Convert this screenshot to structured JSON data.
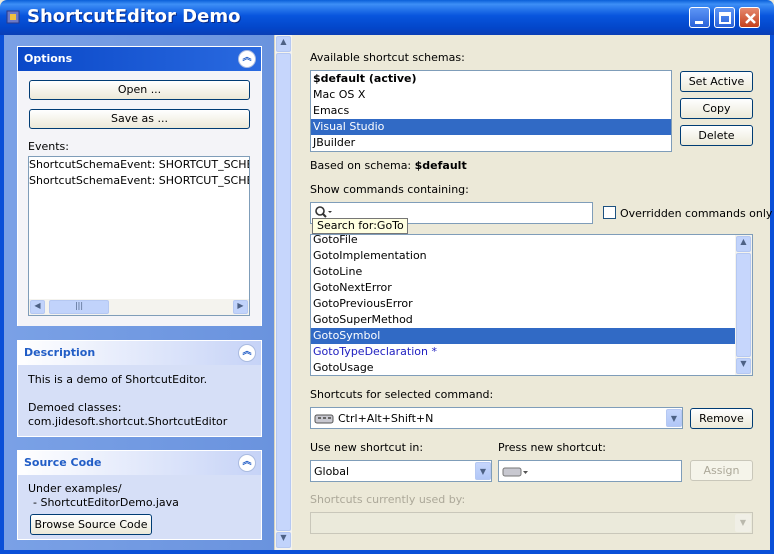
{
  "window": {
    "title": "ShortcutEditor Demo"
  },
  "sidebar": {
    "options": {
      "title": "Options",
      "open_label": "Open ...",
      "saveas_label": "Save as ...",
      "events_label": "Events:",
      "events": [
        "ShortcutSchemaEvent: SHORTCUT_SCHEMA_I",
        "ShortcutSchemaEvent: SHORTCUT_SCHEMA_I"
      ]
    },
    "description": {
      "title": "Description",
      "text": "This is a demo of ShortcutEditor.",
      "demoed_label": "Demoed classes:",
      "demoed_class": "com.jidesoft.shortcut.ShortcutEditor"
    },
    "source": {
      "title": "Source Code",
      "line1": "Under examples/",
      "line2": "- ShortcutEditorDemo.java",
      "browse_label": "Browse Source Code"
    }
  },
  "main": {
    "schemas_label": "Available shortcut schemas:",
    "schemas": [
      {
        "name": "$default (active)",
        "bold": true
      },
      {
        "name": "Mac OS X"
      },
      {
        "name": "Emacs"
      },
      {
        "name": "Visual Studio",
        "selected": true
      },
      {
        "name": "JBuilder"
      }
    ],
    "set_active_label": "Set Active",
    "copy_label": "Copy",
    "delete_label": "Delete",
    "based_on_label": "Based on schema:",
    "based_on_value": "$default",
    "show_commands_label": "Show commands containing:",
    "search_tooltip": "Search for:GoTo",
    "overridden_label": "Overridden commands only",
    "commands": [
      {
        "name": "GotoFile"
      },
      {
        "name": "GotoImplementation"
      },
      {
        "name": "GotoLine"
      },
      {
        "name": "GotoNextError"
      },
      {
        "name": "GotoPreviousError"
      },
      {
        "name": "GotoSuperMethod"
      },
      {
        "name": "GotoSymbol",
        "selected": true
      },
      {
        "name": "GotoTypeDeclaration *",
        "modified": true
      },
      {
        "name": "GotoUsage"
      }
    ],
    "shortcuts_label": "Shortcuts for selected command:",
    "shortcut_value": "Ctrl+Alt+Shift+N",
    "remove_label": "Remove",
    "use_in_label": "Use new shortcut in:",
    "use_in_value": "Global",
    "press_label": "Press new shortcut:",
    "assign_label": "Assign",
    "used_by_label": "Shortcuts currently used by:"
  },
  "colors": {
    "selection": "#316ac5",
    "modified_text": "#2020c0",
    "titlebar": "#0a5fd8"
  }
}
